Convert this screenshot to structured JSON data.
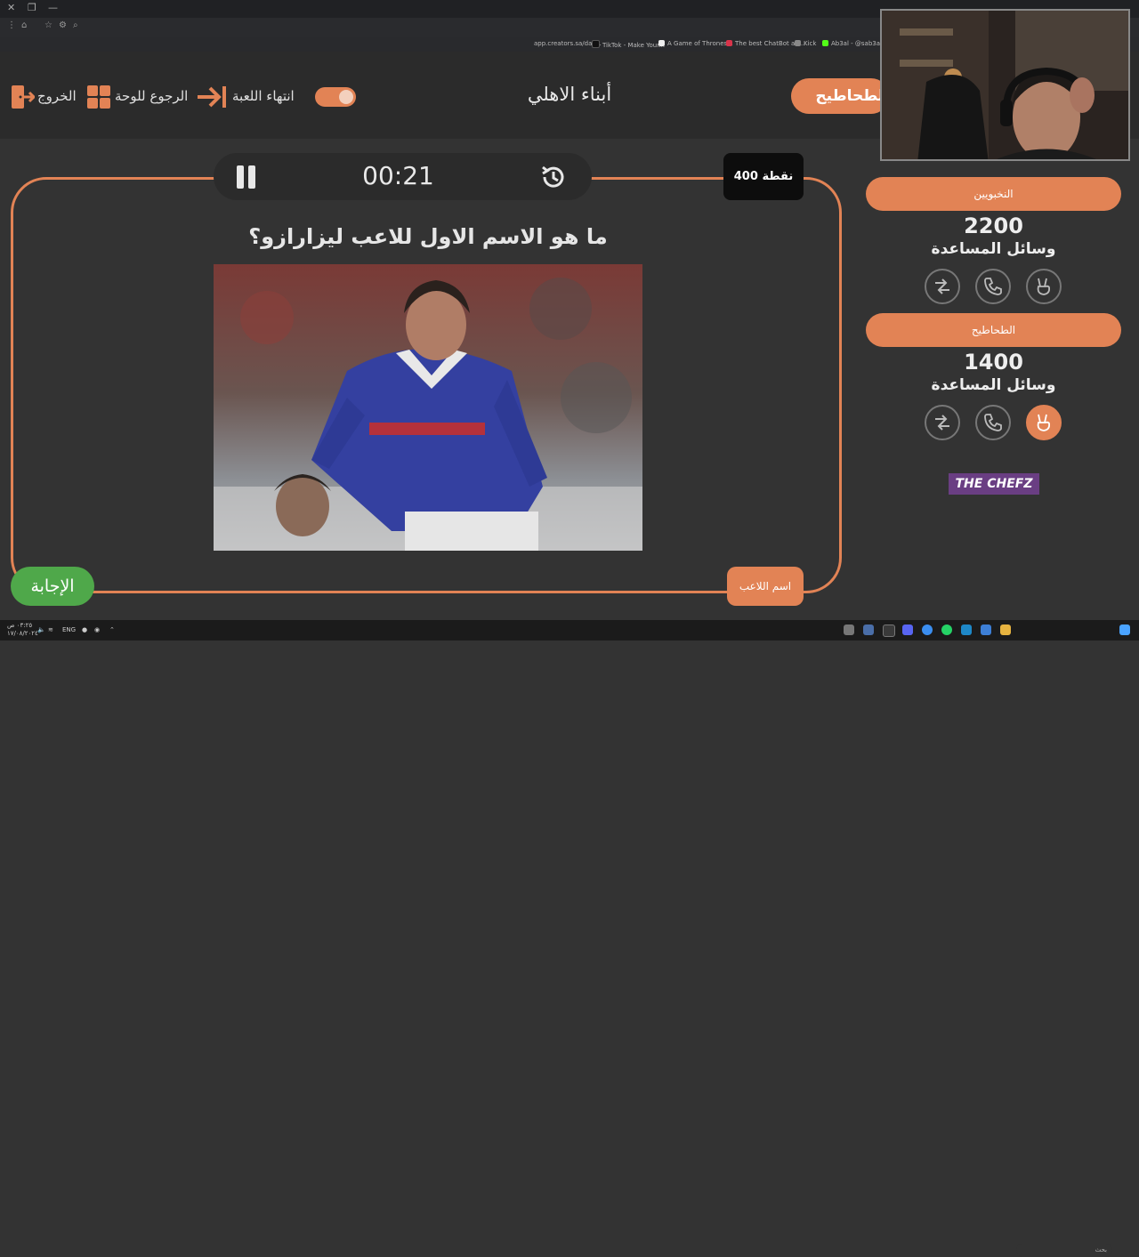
{
  "browser": {
    "bookmarks": [
      {
        "label": "app.creators.sa/das...",
        "color": "#4a7bd0"
      },
      {
        "label": "TikTok - Make Your...",
        "color": "#111111"
      },
      {
        "label": "A Game of Thrones...",
        "color": "#eeeeee"
      },
      {
        "label": "The best ChatBot an...",
        "color": "#d9334a"
      },
      {
        "label": "Kick",
        "color": "#53fc18"
      },
      {
        "label": "Ab3al - @sab3al |",
        "color": "#53fc18"
      }
    ]
  },
  "header": {
    "exit_label": "الخروج",
    "back_board_label": "الرجوع للوحة",
    "end_game_label": "انتهاء اللعبة",
    "team_title": "أبناء الاهلي",
    "active_team_pill": "الطحاطيح"
  },
  "game": {
    "timer": "00:21",
    "points_badge": "400 نقطة",
    "question": "ما هو الاسم الاول للاعب ليزارازو؟",
    "hint_label": "اسم اللاعب",
    "answer_label": "الإجابة"
  },
  "teams": [
    {
      "name": "النخبويين",
      "score": "2200",
      "aids_label": "وسائل المساعدة"
    },
    {
      "name": "الطحاطيح",
      "score": "1400",
      "aids_label": "وسائل المساعدة"
    }
  ],
  "brand": {
    "logo_text": "THE CHEFZ"
  },
  "taskbar": {
    "language": "ENG",
    "time": "٠٣:٢٥ ص",
    "date": "١٧/٠٨/٢٠٢٤",
    "search_placeholder": "بحث"
  },
  "colors": {
    "accent": "#e28355",
    "answer": "#4fa84a",
    "background": "#333333"
  }
}
